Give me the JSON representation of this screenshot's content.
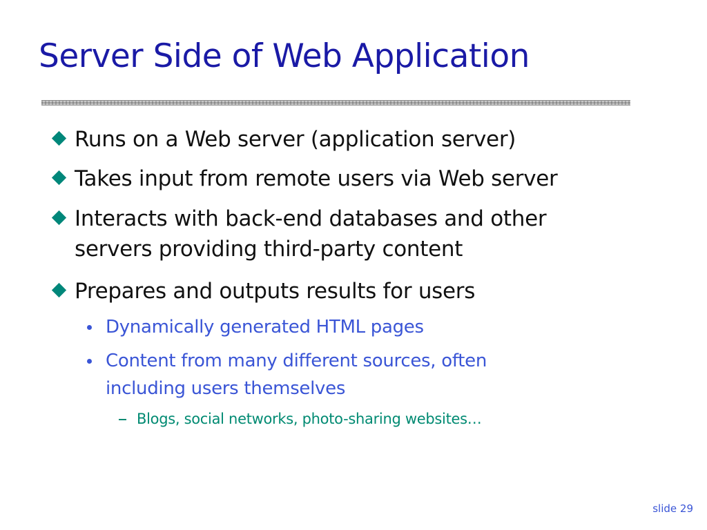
{
  "slide": {
    "title": "Server Side of Web Application",
    "bullets": [
      {
        "lines": [
          "Runs on a Web server (application server)"
        ]
      },
      {
        "lines": [
          "Takes input from remote users via Web server"
        ]
      },
      {
        "lines": [
          "Interacts with back-end databases and other",
          "servers providing third-party content"
        ]
      },
      {
        "lines": [
          "Prepares and outputs results for users"
        ]
      }
    ],
    "sub_bullets": [
      {
        "lines": [
          "Dynamically generated HTML pages"
        ]
      },
      {
        "lines": [
          "Content from many different sources, often",
          "including users themselves"
        ]
      }
    ],
    "sub_sub_bullets": [
      {
        "lines": [
          "Blogs, social networks, photo-sharing websites…"
        ]
      }
    ],
    "slide_number": "slide 29"
  },
  "colors": {
    "title": "#1a1aa6",
    "level1_text": "#111111",
    "level1_bullet": "#00877a",
    "level2": "#3a55d6",
    "level3": "#008a72"
  },
  "icons": {
    "level1_bullet": "diamond-bullet-icon",
    "level2_bullet": "dot-bullet-icon",
    "level3_bullet": "dash-bullet-icon"
  }
}
